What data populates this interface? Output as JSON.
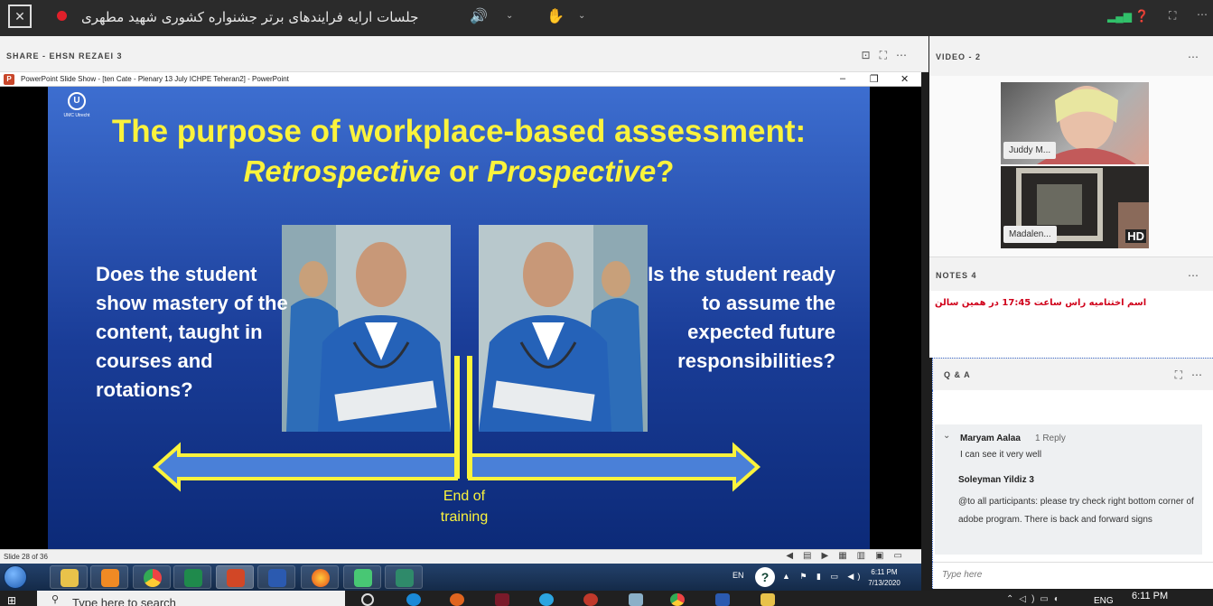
{
  "topbar": {
    "meeting_title": "جلسات ارایه فرایندهای برتر جشنواره کشوری شهید مطهری"
  },
  "share": {
    "pod_title": "SHARE  - EHSN REZAEI 3",
    "pp_window_title": "PowerPoint Slide Show - [ten Cate - Plenary 13 July ICHPE Teheran2] - PowerPoint",
    "slide": {
      "logo_text": "UMC Utrecht",
      "title_line1": "The purpose of workplace-based assessment:",
      "title_word1": "Retrospective",
      "title_or": " or ",
      "title_word2": "Prospective",
      "title_q": "?",
      "left_text": "Does the student show mastery of the content, taught in courses and rotations?",
      "right_text": "Is the student ready to assume the expected future responsibilities?",
      "center_label": "End of training"
    },
    "slide_status": "Slide 28 of 36",
    "tray_lang": "EN",
    "tray_time": "6:11 PM",
    "tray_date": "7/13/2020"
  },
  "video": {
    "title": "VIDEO  - 2",
    "participants": [
      {
        "name": "Juddy M..."
      },
      {
        "name": "Madalen...",
        "badge": "HD"
      }
    ]
  },
  "notes": {
    "title": "NOTES 4",
    "text": "اسم اختتامیه راس ساعت 17:45 در همین سالن"
  },
  "qa": {
    "title": "Q & A",
    "question": {
      "asker": "Maryam Aalaa",
      "replies": "1 Reply",
      "text": "I can see it very well"
    },
    "answer": {
      "name": "Soleyman Yildiz 3",
      "text": "@to all participants: please try check right bottom corner of adobe program. There is back and forward signs"
    },
    "input_placeholder": "Type here"
  },
  "taskbar": {
    "search_placeholder": "Type here to search",
    "lang": "ENG",
    "time": "6:11 PM"
  },
  "colors": {
    "slide_title": "#fbf33c",
    "slide_bg_top": "#3d6ed0",
    "slide_bg_bottom": "#0c2a78",
    "notes_text": "#d0021b",
    "rec_dot": "#e0202a"
  }
}
